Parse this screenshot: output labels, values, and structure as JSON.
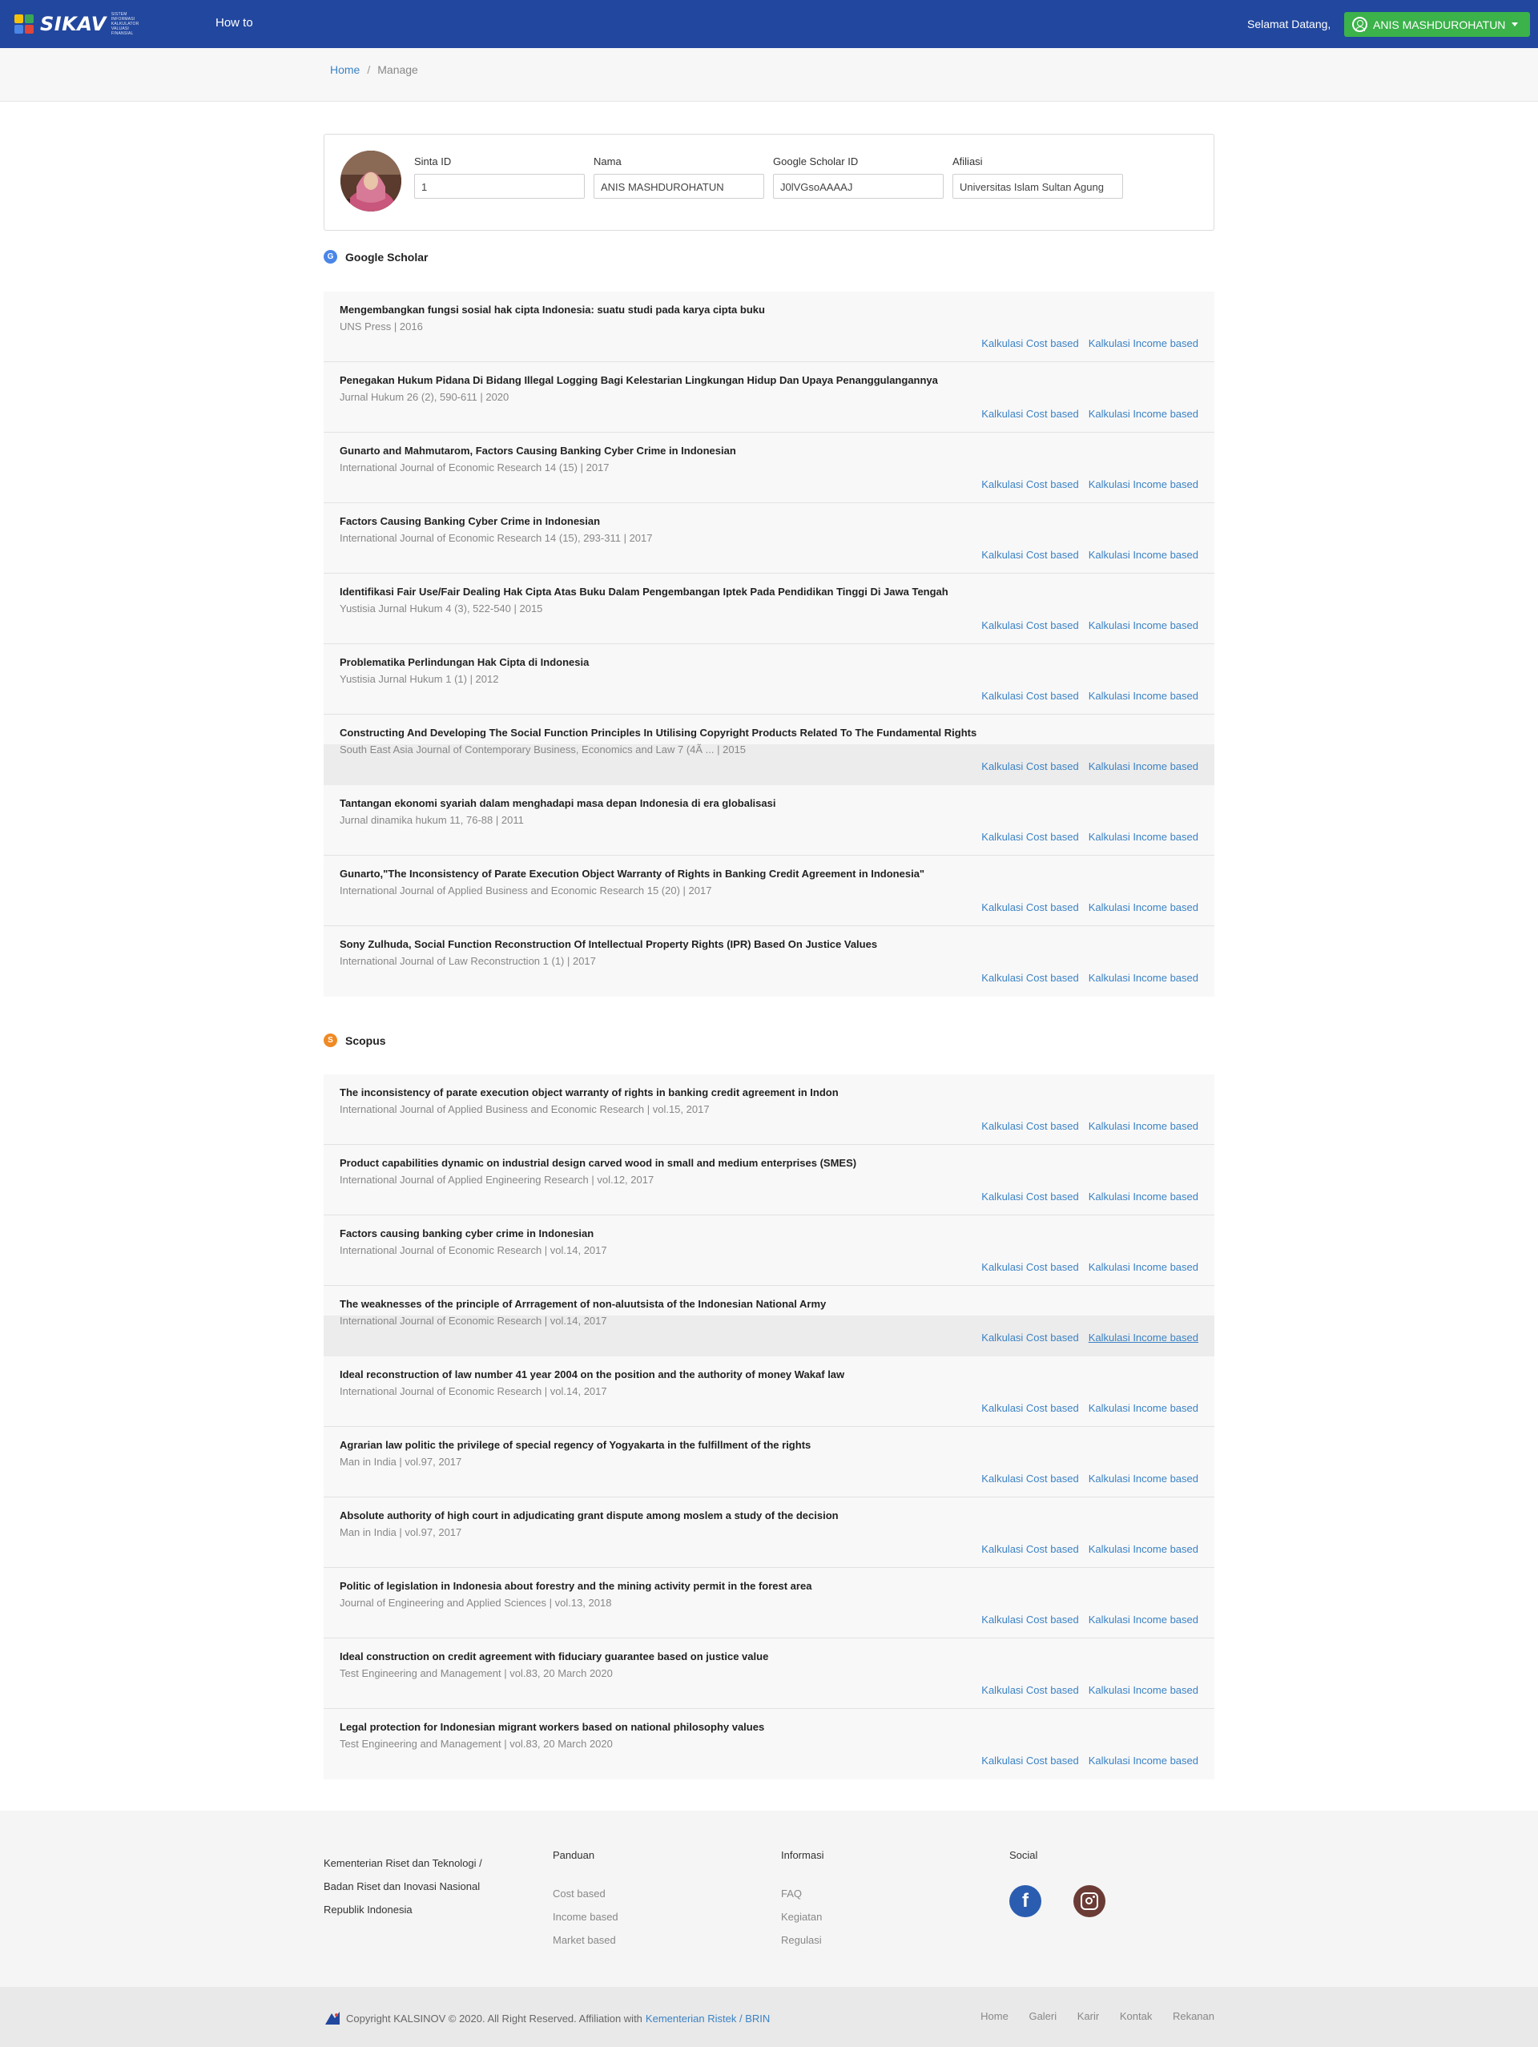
{
  "nav": {
    "logo_text": "SIKAV",
    "logo_tagline": "SISTEM INFORMASI KALKULATOR VALUASI FINANSIAL",
    "how_to": "How to",
    "welcome": "Selamat Datang,",
    "user_name": "ANIS MASHDUROHATUN"
  },
  "breadcrumb": {
    "home": "Home",
    "sep": "/",
    "current": "Manage"
  },
  "profile": {
    "sinta_label": "Sinta ID",
    "sinta_value": "1",
    "nama_label": "Nama",
    "nama_value": "ANIS MASHDUROHATUN",
    "scholar_label": "Google Scholar ID",
    "scholar_value": "J0lVGsoAAAAJ",
    "afiliasi_label": "Afiliasi",
    "afiliasi_value": "Universitas Islam Sultan Agung"
  },
  "links": {
    "cost": "Kalkulasi Cost based",
    "income": "Kalkulasi Income based"
  },
  "google_scholar": {
    "heading": "Google Scholar",
    "items": [
      {
        "title": "Mengembangkan fungsi sosial hak cipta Indonesia: suatu studi pada karya cipta buku",
        "meta": "UNS Press | 2016"
      },
      {
        "title": "Penegakan Hukum Pidana Di Bidang Illegal Logging Bagi Kelestarian Lingkungan Hidup Dan Upaya Penanggulangannya",
        "meta": "Jurnal Hukum 26 (2), 590-611 | 2020"
      },
      {
        "title": "Gunarto and Mahmutarom, Factors Causing Banking Cyber Crime in Indonesian",
        "meta": "International Journal of Economic Research 14 (15) | 2017"
      },
      {
        "title": "Factors Causing Banking Cyber Crime in Indonesian",
        "meta": "International Journal of Economic Research 14 (15), 293-311 | 2017"
      },
      {
        "title": "Identifikasi Fair Use/Fair Dealing Hak Cipta Atas Buku Dalam Pengembangan Iptek Pada Pendidikan Tinggi Di Jawa Tengah",
        "meta": "Yustisia Jurnal Hukum 4 (3), 522-540 | 2015"
      },
      {
        "title": "Problematika Perlindungan Hak Cipta di Indonesia",
        "meta": "Yustisia Jurnal Hukum 1 (1) | 2012"
      },
      {
        "title": "Constructing And Developing The Social Function Principles In Utilising Copyright Products Related To The Fundamental Rights",
        "meta": "South East Asia Journal of Contemporary Business, Economics and Law 7 (4Ã ... | 2015"
      },
      {
        "title": "Tantangan ekonomi syariah dalam menghadapi masa depan Indonesia di era globalisasi",
        "meta": "Jurnal dinamika hukum 11, 76-88 | 2011"
      },
      {
        "title": "Gunarto,\"The Inconsistency of Parate Execution Object Warranty of Rights in Banking Credit Agreement in Indonesia\"",
        "meta": "International Journal of Applied Business and Economic Research 15 (20) | 2017"
      },
      {
        "title": "Sony Zulhuda, Social Function Reconstruction Of Intellectual Property Rights (IPR) Based On Justice Values",
        "meta": "International Journal of Law Reconstruction 1 (1) | 2017"
      }
    ]
  },
  "scopus": {
    "heading": "Scopus",
    "items": [
      {
        "title": "The inconsistency of parate execution object warranty of rights in banking credit agreement in Indon",
        "meta": "International Journal of Applied Business and Economic Research | vol.15, 2017"
      },
      {
        "title": "Product capabilities dynamic on industrial design carved wood in small and medium enterprises (SMES)",
        "meta": "International Journal of Applied Engineering Research | vol.12, 2017"
      },
      {
        "title": "Factors causing banking cyber crime in Indonesian",
        "meta": "International Journal of Economic Research | vol.14, 2017"
      },
      {
        "title": "The weaknesses of the principle of Arrragement of non-aluutsista of the Indonesian National Army",
        "meta": "International Journal of Economic Research | vol.14, 2017"
      },
      {
        "title": "Ideal reconstruction of law number 41 year 2004 on the position and the authority of money Wakaf law",
        "meta": "International Journal of Economic Research | vol.14, 2017"
      },
      {
        "title": "Agrarian law politic the privilege of special regency of Yogyakarta in the fulfillment of the rights",
        "meta": "Man in India | vol.97, 2017"
      },
      {
        "title": "Absolute authority of high court in adjudicating grant dispute among moslem a study of the decision",
        "meta": "Man in India | vol.97, 2017"
      },
      {
        "title": "Politic of legislation in Indonesia about forestry and the mining activity permit in the forest area",
        "meta": "Journal of Engineering and Applied Sciences | vol.13, 2018"
      },
      {
        "title": "Ideal construction on credit agreement with fiduciary guarantee based on justice value",
        "meta": "Test Engineering and Management | vol.83, 20 March 2020"
      },
      {
        "title": "Legal protection for Indonesian migrant workers based on national philosophy values",
        "meta": "Test Engineering and Management | vol.83, 20 March 2020"
      }
    ]
  },
  "footer": {
    "org_line1": "Kementerian Riset dan Teknologi /",
    "org_line2": "Badan Riset dan Inovasi Nasional",
    "org_line3": "Republik Indonesia",
    "panduan": {
      "heading": "Panduan",
      "items": [
        "Cost based",
        "Income based",
        "Market based"
      ]
    },
    "informasi": {
      "heading": "Informasi",
      "items": [
        "FAQ",
        "Kegiatan",
        "Regulasi"
      ]
    },
    "social": {
      "heading": "Social"
    },
    "copyright": "Copyright KALSINOV © 2020. All Right Reserved. Affiliation with",
    "ministry": "Kementerian Ristek / BRIN",
    "bottom_links": [
      "Home",
      "Galeri",
      "Karir",
      "Kontak",
      "Rekanan"
    ]
  },
  "colors": {
    "navbar": "#22479e",
    "user_button": "#3bb24a",
    "link": "#3b82c4",
    "scopus_icon": "#f08a24",
    "scholar_icon": "#4a86e8"
  }
}
